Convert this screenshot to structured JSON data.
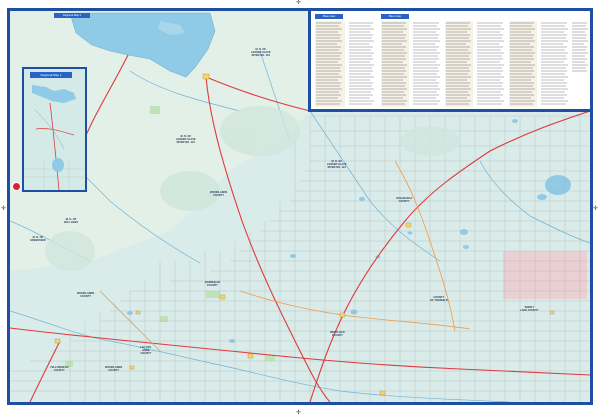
{
  "inset_map": {
    "title": "Regional Map 1"
  },
  "top_inset": {
    "title": "Regional Map 2"
  },
  "index": {
    "heading_1": "Place Index",
    "heading_2": "Place Index"
  },
  "labels": [
    {
      "id": "lbl-1",
      "text": "M. D. OF\nLESSER SLAVE\nRIVER NO. 124"
    },
    {
      "id": "lbl-2",
      "text": "M. D. OF\nLESSER SLAVE\nRIVER NO. 124"
    },
    {
      "id": "lbl-3",
      "text": "M. D. OF\nLESSER SLAVE\nRIVER NO. 124"
    },
    {
      "id": "lbl-4",
      "text": "WOODLANDS\nCOUNTY"
    },
    {
      "id": "lbl-5",
      "text": "M. D. OF\nBIG LAKES"
    },
    {
      "id": "lbl-6",
      "text": "WOODLANDS\nCOUNTY"
    },
    {
      "id": "lbl-7",
      "text": "ATHABASCA\nCOUNTY"
    },
    {
      "id": "lbl-8",
      "text": "SMOKY\nLAKE COUNTY"
    },
    {
      "id": "lbl-9",
      "text": "COUNTY\nOF THORHILD"
    },
    {
      "id": "lbl-10",
      "text": "LAC STE.\nANNE\nCOUNTY"
    },
    {
      "id": "lbl-11",
      "text": "WOODLANDS\nCOUNTY"
    },
    {
      "id": "lbl-12",
      "text": "YELLOWHEAD\nCOUNTY"
    },
    {
      "id": "lbl-13",
      "text": "BARRHEAD\nCOUNTY"
    },
    {
      "id": "lbl-14",
      "text": "WESTLOCK\nCOUNTY"
    },
    {
      "id": "lbl-15",
      "text": "M. D. OF\nGREENVIEW"
    }
  ],
  "colors": {
    "frame": "#1f4fa3",
    "land": "#d9ecea",
    "water": "#8fcbe6",
    "road_major": "#e0393e",
    "road_minor": "#a7a7a7",
    "park": "#bfe3b5",
    "reserve": "#f1c5c7"
  }
}
